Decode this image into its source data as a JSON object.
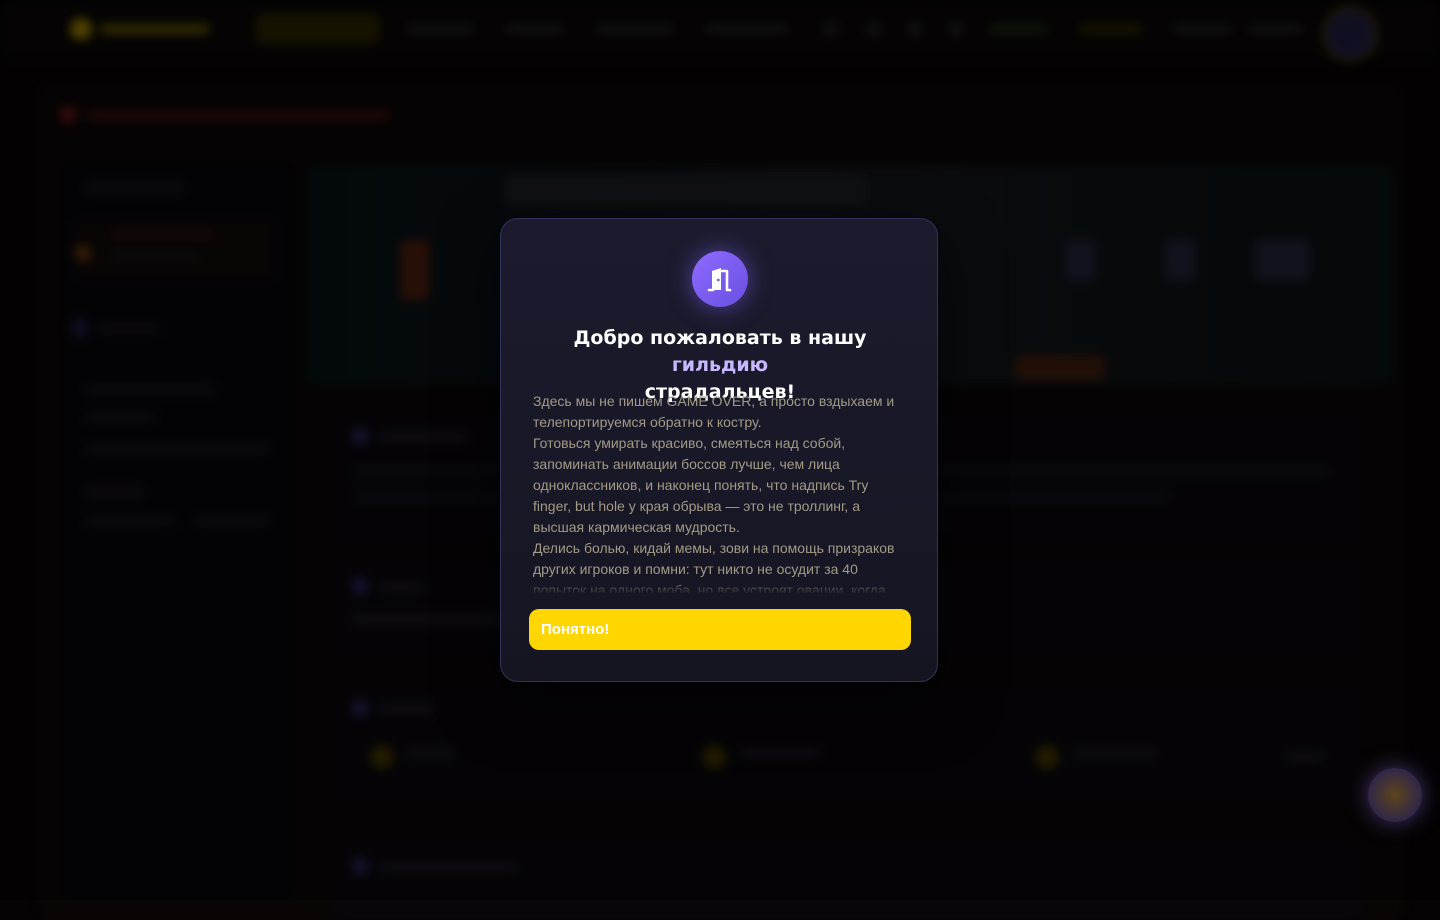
{
  "modal": {
    "icon": "door-icon",
    "title_part1": "Добро пожаловать в нашу ",
    "title_accent": "гильдию",
    "title_part2": "страдальцев!",
    "paragraphs": [
      "Здесь мы не пишем GAME OVER, а просто вздыхаем и телепортируемся обратно к костру.",
      "Готовься умирать красиво, смеяться над собой, запоминать анимации боссов лучше, чем лица одноклассников, и наконец понять, что надпись Try finger, but hole у края обрыва — это не троллинг, а высшая кармическая мудрость.",
      "Делись болью, кидай мемы, зови на помощь призраков других игроков и помни: тут никто не осудит за 40 попыток на одного моба, но все устроят овации, когда"
    ],
    "button_label": "Понятно!"
  },
  "colors": {
    "accent_yellow": "#ffd600",
    "accent_purple": "#7b5cf5",
    "modal_bg": "#1a1a2b",
    "title_accent": "#c9b8ff"
  }
}
